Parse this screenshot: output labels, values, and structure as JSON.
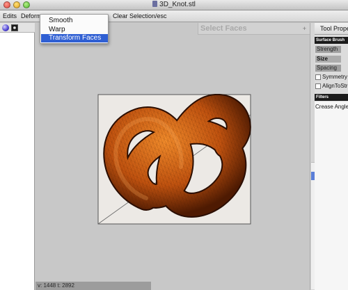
{
  "window": {
    "title": "3D_Knot.stl"
  },
  "toolbar": {
    "edits": "Edits",
    "deform": "Deform",
    "clear_selection": "Clear Selection/esc"
  },
  "deform_menu": {
    "items": [
      {
        "label": "Smooth",
        "selected": false
      },
      {
        "label": "Warp",
        "selected": false
      },
      {
        "label": "Transform Faces",
        "selected": true
      }
    ]
  },
  "viewport": {
    "panel_title": "Select Faces",
    "panel_plus": "+",
    "status": "v: 1448  t: 2892",
    "mesh_color": "#c0520f"
  },
  "right_panel": {
    "tab_label": "Tool Properties",
    "surface_brush_header": "Surface Brush",
    "sliders": {
      "strength": "Strength",
      "size": "Size",
      "spacing": "Spacing"
    },
    "checkboxes": {
      "symmetry": "Symmetry",
      "align": "AlignToStroke"
    },
    "filters_header": "Filters",
    "crease_angle": "Crease Angle"
  },
  "colors": {
    "menu_highlight": "#2f5fd3",
    "viewport_bg": "#c8c8c8"
  }
}
